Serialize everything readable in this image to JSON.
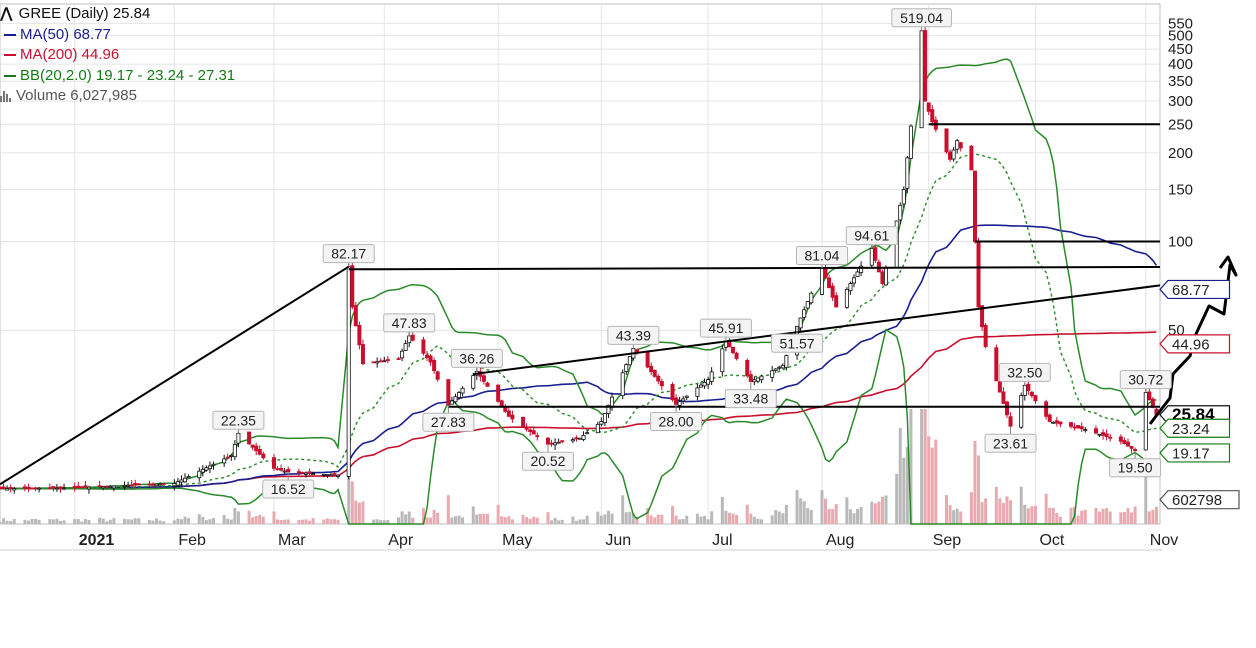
{
  "chart_data": {
    "type": "candlestick",
    "symbol_label": "GREE (Daily) 25.84",
    "ticker_icon": "stockchart-logo-glyph",
    "legend": [
      {
        "key": "ma50",
        "label": "MA(50) 68.77",
        "color": "#1a1f8f"
      },
      {
        "key": "ma200",
        "label": "MA(200) 44.96",
        "color": "#c8102e"
      },
      {
        "key": "bb",
        "label": "BB(20,2.0) 19.17 - 23.24 - 27.31",
        "color": "#167a16"
      },
      {
        "key": "vol",
        "label": "Volume 6,027,985",
        "color": "#777777"
      }
    ],
    "yscale": "log",
    "ylim": [
      11,
      640
    ],
    "yticks": [
      550,
      500,
      450,
      400,
      350,
      300,
      250,
      200,
      150,
      100,
      50
    ],
    "xlabels": [
      {
        "label": "2021",
        "bold": true,
        "date": "2021-01-04"
      },
      {
        "label": "Feb",
        "date": "2021-02-01"
      },
      {
        "label": "Mar",
        "date": "2021-03-01"
      },
      {
        "label": "Apr",
        "date": "2021-04-01"
      },
      {
        "label": "May",
        "date": "2021-05-03"
      },
      {
        "label": "Jun",
        "date": "2021-06-01"
      },
      {
        "label": "Jul",
        "date": "2021-07-01"
      },
      {
        "label": "Aug",
        "date": "2021-08-02"
      },
      {
        "label": "Sep",
        "date": "2021-09-01"
      },
      {
        "label": "Oct",
        "date": "2021-10-01"
      },
      {
        "label": "Nov",
        "date": "2021-11-01"
      }
    ],
    "price_series": [
      {
        "date": "2020-12-14",
        "close": 14.5
      },
      {
        "date": "2021-01-04",
        "close": 14.6
      },
      {
        "date": "2021-01-20",
        "close": 14.9
      },
      {
        "date": "2021-02-01",
        "close": 15.1
      },
      {
        "date": "2021-02-17",
        "close": 18.8
      },
      {
        "date": "2021-02-19",
        "close": 22.35
      },
      {
        "date": "2021-03-01",
        "close": 17.0
      },
      {
        "date": "2021-03-05",
        "close": 16.52
      },
      {
        "date": "2021-03-19",
        "close": 16.1
      },
      {
        "date": "2021-03-22",
        "close": 82.17
      },
      {
        "date": "2021-03-23",
        "close": 60.0
      },
      {
        "date": "2021-03-26",
        "close": 38.5
      },
      {
        "date": "2021-04-05",
        "close": 40.0
      },
      {
        "date": "2021-04-08",
        "close": 47.83
      },
      {
        "date": "2021-04-14",
        "close": 39.0
      },
      {
        "date": "2021-04-19",
        "close": 27.83
      },
      {
        "date": "2021-04-27",
        "close": 36.26
      },
      {
        "date": "2021-05-06",
        "close": 25.5
      },
      {
        "date": "2021-05-17",
        "close": 20.52
      },
      {
        "date": "2021-05-26",
        "close": 21.5
      },
      {
        "date": "2021-06-01",
        "close": 24.5
      },
      {
        "date": "2021-06-10",
        "close": 43.39
      },
      {
        "date": "2021-06-22",
        "close": 28.0
      },
      {
        "date": "2021-07-01",
        "close": 34.0
      },
      {
        "date": "2021-07-06",
        "close": 45.91
      },
      {
        "date": "2021-07-13",
        "close": 33.48
      },
      {
        "date": "2021-07-22",
        "close": 38.0
      },
      {
        "date": "2021-07-26",
        "close": 51.57
      },
      {
        "date": "2021-08-02",
        "close": 81.04
      },
      {
        "date": "2021-08-06",
        "close": 60.0
      },
      {
        "date": "2021-08-16",
        "close": 94.61
      },
      {
        "date": "2021-08-19",
        "close": 72.0
      },
      {
        "date": "2021-08-25",
        "close": 150.0
      },
      {
        "date": "2021-08-30",
        "close": 519.04
      },
      {
        "date": "2021-08-31",
        "close": 300.0
      },
      {
        "date": "2021-09-02",
        "close": 255.0
      },
      {
        "date": "2021-09-07",
        "close": 190.0
      },
      {
        "date": "2021-09-09",
        "close": 220.0
      },
      {
        "date": "2021-09-13",
        "close": 175.0
      },
      {
        "date": "2021-09-14",
        "close": 100.0
      },
      {
        "date": "2021-09-15",
        "close": 60.0
      },
      {
        "date": "2021-09-17",
        "close": 44.0
      },
      {
        "date": "2021-09-24",
        "close": 23.61
      },
      {
        "date": "2021-09-28",
        "close": 32.5
      },
      {
        "date": "2021-10-05",
        "close": 24.5
      },
      {
        "date": "2021-10-15",
        "close": 23.0
      },
      {
        "date": "2021-10-25",
        "close": 21.0
      },
      {
        "date": "2021-10-29",
        "close": 19.5
      },
      {
        "date": "2021-11-01",
        "close": 30.72
      },
      {
        "date": "2021-11-04",
        "close": 25.84
      }
    ],
    "annotations": [
      {
        "label": "22.35",
        "date": "2021-02-19",
        "value": 22.35,
        "pos": "above"
      },
      {
        "label": "16.52",
        "date": "2021-03-05",
        "value": 16.52,
        "pos": "below"
      },
      {
        "label": "82.17",
        "date": "2021-03-22",
        "value": 82.17,
        "pos": "above"
      },
      {
        "label": "47.83",
        "date": "2021-04-08",
        "value": 47.83,
        "pos": "above"
      },
      {
        "label": "27.83",
        "date": "2021-04-19",
        "value": 27.83,
        "pos": "below"
      },
      {
        "label": "36.26",
        "date": "2021-04-27",
        "value": 36.26,
        "pos": "above"
      },
      {
        "label": "20.52",
        "date": "2021-05-17",
        "value": 20.52,
        "pos": "below"
      },
      {
        "label": "43.39",
        "date": "2021-06-10",
        "value": 43.39,
        "pos": "above"
      },
      {
        "label": "28.00",
        "date": "2021-06-22",
        "value": 28.0,
        "pos": "below"
      },
      {
        "label": "45.91",
        "date": "2021-07-06",
        "value": 45.91,
        "pos": "above"
      },
      {
        "label": "33.48",
        "date": "2021-07-13",
        "value": 33.48,
        "pos": "below"
      },
      {
        "label": "51.57",
        "date": "2021-07-26",
        "value": 51.57,
        "pos": "below"
      },
      {
        "label": "81.04",
        "date": "2021-08-02",
        "value": 81.04,
        "pos": "above"
      },
      {
        "label": "94.61",
        "date": "2021-08-16",
        "value": 94.61,
        "pos": "above"
      },
      {
        "label": "519.04",
        "date": "2021-08-30",
        "value": 519.04,
        "pos": "above"
      },
      {
        "label": "32.50",
        "date": "2021-09-28",
        "value": 32.5,
        "pos": "above"
      },
      {
        "label": "23.61",
        "date": "2021-09-24",
        "value": 23.61,
        "pos": "below"
      },
      {
        "label": "30.72",
        "date": "2021-11-01",
        "value": 30.72,
        "pos": "above"
      },
      {
        "label": "19.50",
        "date": "2021-10-29",
        "value": 19.5,
        "pos": "below"
      }
    ],
    "right_tags": [
      {
        "label": "68.77",
        "value": 68.77,
        "color": "#1a1f8f",
        "bold": false
      },
      {
        "label": "44.96",
        "value": 44.96,
        "color": "#c8102e",
        "bold": false
      },
      {
        "label": "25.84",
        "value": 25.84,
        "color": "#111111",
        "bold": true
      },
      {
        "label": "23.24",
        "value": 23.24,
        "color": "#167a16",
        "bold": false
      },
      {
        "label": "19.17",
        "value": 19.17,
        "color": "#167a16",
        "bold": false
      },
      {
        "label": "602798",
        "value": 13.3,
        "color": "#555555",
        "bold": false
      }
    ],
    "drawn_lines": [
      {
        "from": {
          "date": "2020-12-14",
          "value": 15.0
        },
        "to": {
          "date": "2021-03-22",
          "value": 82.17
        }
      },
      {
        "from": {
          "date": "2021-03-22",
          "value": 80.5
        },
        "to": {
          "date": "2021-11-05",
          "value": 82.0
        }
      },
      {
        "from": {
          "date": "2021-04-26",
          "value": 35.5
        },
        "to": {
          "date": "2021-11-05",
          "value": 71.0
        }
      },
      {
        "from": {
          "date": "2021-04-19",
          "value": 27.5
        },
        "to": {
          "date": "2021-11-05",
          "value": 27.5
        }
      },
      {
        "from": {
          "date": "2021-09-01",
          "value": 250.0
        },
        "to": {
          "date": "2021-11-05",
          "value": 250.0
        }
      },
      {
        "from": {
          "date": "2021-09-14",
          "value": 100.0
        },
        "to": {
          "date": "2021-11-05",
          "value": 100.0
        }
      }
    ],
    "grid": true
  }
}
